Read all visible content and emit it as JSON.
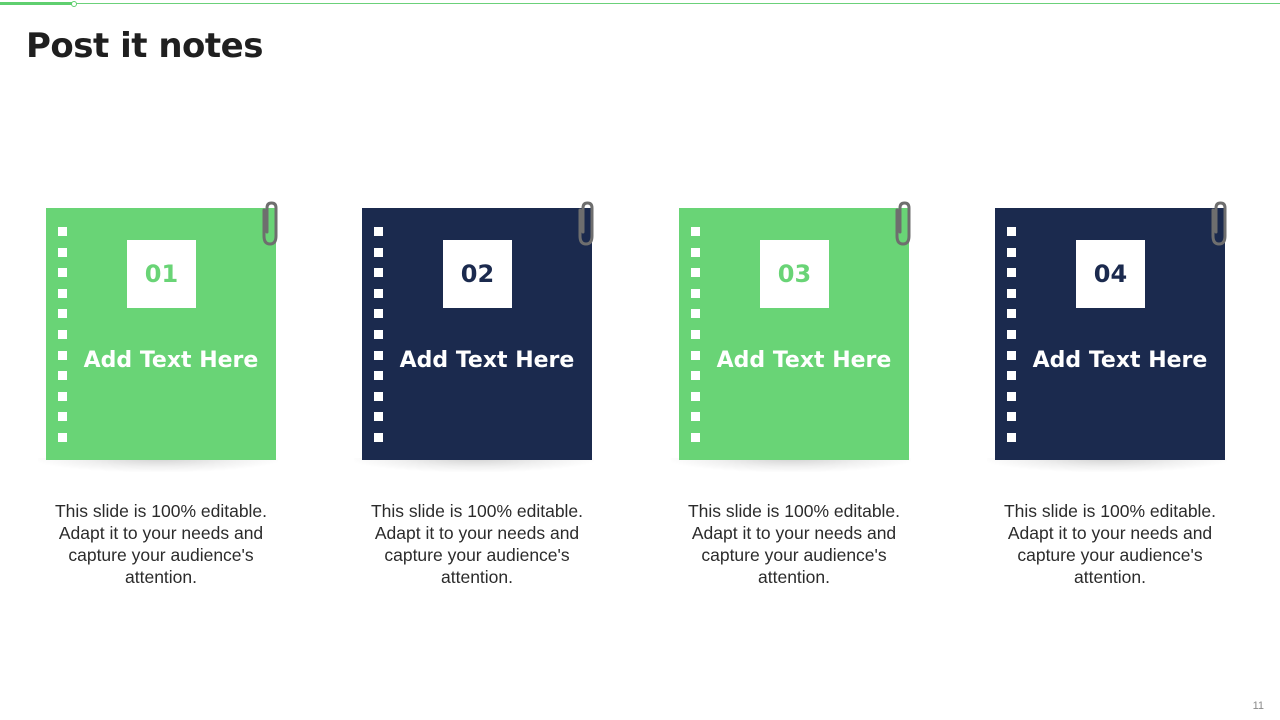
{
  "slide": {
    "title": "Post it notes",
    "page_number": "11"
  },
  "colors": {
    "green": "#69d476",
    "navy": "#1b2a4e",
    "accent_line": "#6bd17a",
    "clip": "#6e6e6e"
  },
  "notes": [
    {
      "number": "01",
      "heading": "Add Text Here",
      "color": "green",
      "description": "This slide is 100% editable. Adapt it to your needs and capture your audience's attention."
    },
    {
      "number": "02",
      "heading": "Add Text Here",
      "color": "navy",
      "description": "This slide is 100% editable. Adapt it to your needs and capture your audience's attention."
    },
    {
      "number": "03",
      "heading": "Add Text Here",
      "color": "green",
      "description": "This slide is 100% editable. Adapt it to your needs and capture your audience's attention."
    },
    {
      "number": "04",
      "heading": "Add Text Here",
      "color": "navy",
      "description": "This slide is 100% editable. Adapt it to your needs and capture your audience's attention."
    }
  ]
}
